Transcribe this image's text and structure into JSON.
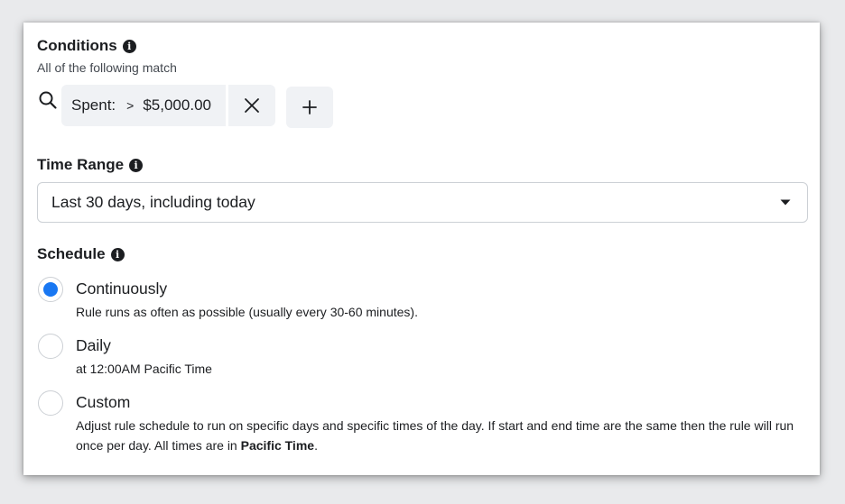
{
  "conditions": {
    "title": "Conditions",
    "subtitle": "All of the following match",
    "filter": {
      "field": "Spent:",
      "operator": ">",
      "value": "$5,000.00"
    }
  },
  "time_range": {
    "title": "Time Range",
    "selected": "Last 30 days, including today"
  },
  "schedule": {
    "title": "Schedule",
    "options": [
      {
        "label": "Continuously",
        "description": "Rule runs as often as possible (usually every 30-60 minutes).",
        "selected": true
      },
      {
        "label": "Daily",
        "description": "at 12:00AM Pacific Time",
        "selected": false
      },
      {
        "label": "Custom",
        "description_part1": "Adjust rule schedule to run on specific days and specific times of the day. If start and end time are the same then the rule will run once per day. All times are in ",
        "description_bold": "Pacific Time",
        "description_end": ".",
        "selected": false
      }
    ]
  },
  "colors": {
    "accent": "#1877f2",
    "chip_bg": "#f0f2f5",
    "border": "#ccd0d5"
  }
}
